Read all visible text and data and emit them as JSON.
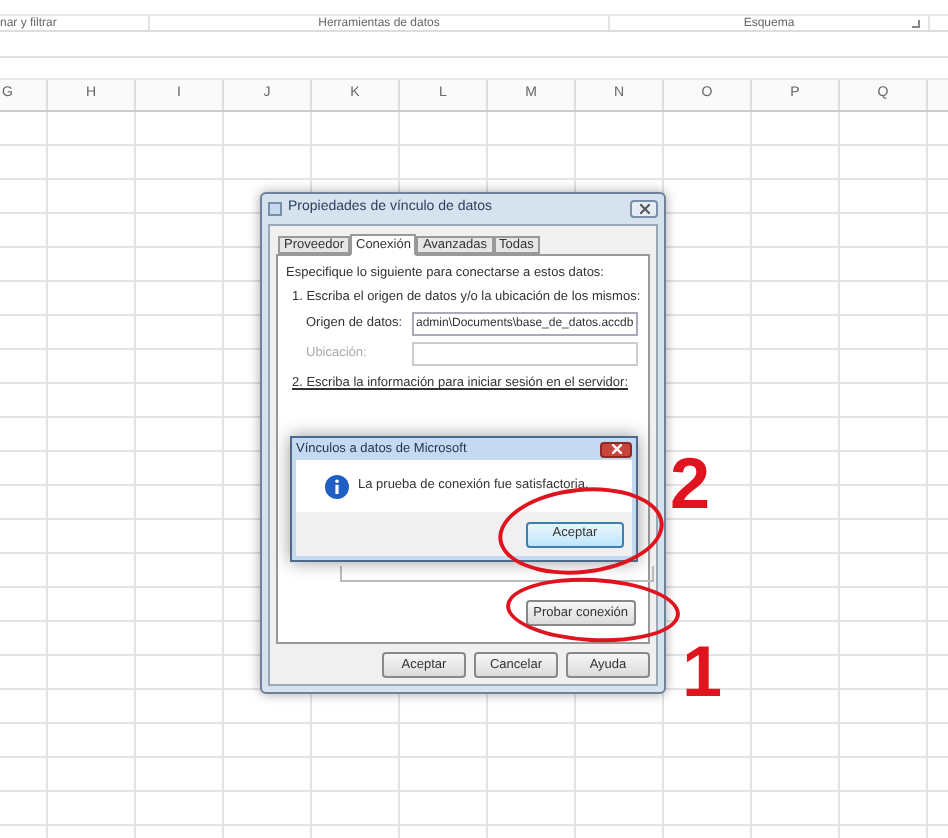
{
  "ribbon": {
    "groups": [
      {
        "label": "nar y filtrar",
        "launcher": false
      },
      {
        "label": "Herramientas de datos",
        "launcher": false
      },
      {
        "label": "Esquema",
        "launcher": true
      }
    ]
  },
  "sheet": {
    "columns": [
      "G",
      "H",
      "I",
      "J",
      "K",
      "L",
      "M",
      "N",
      "O",
      "P",
      "Q"
    ]
  },
  "dialog": {
    "title": "Propiedades de vínculo de datos",
    "tabs": [
      {
        "label": "Proveedor",
        "selected": false
      },
      {
        "label": "Conexión",
        "selected": true
      },
      {
        "label": "Avanzadas",
        "selected": false
      },
      {
        "label": "Todas",
        "selected": false
      }
    ],
    "intro": "Especifique lo siguiente para conectarse a estos datos:",
    "step_1": "1. Escriba el origen de datos y/o la ubicación de los mismos:",
    "fields": [
      {
        "label": "Origen de datos:",
        "value": "admin\\Documents\\base_de_datos.accdb",
        "disabled": false
      },
      {
        "label": "Ubicación:",
        "disabled": true
      }
    ],
    "step_2": "2. Escriba la información para iniciar sesión en el servidor:",
    "test_button": "Probar conexión",
    "buttons": [
      "Aceptar",
      "Cancelar",
      "Ayuda"
    ]
  },
  "message_box": {
    "title": "Vínculos a datos de Microsoft",
    "message": "La prueba de conexión fue satisfactoria.",
    "button": "Aceptar"
  },
  "annotations": [
    {
      "label": "2"
    },
    {
      "label": "1"
    }
  ]
}
